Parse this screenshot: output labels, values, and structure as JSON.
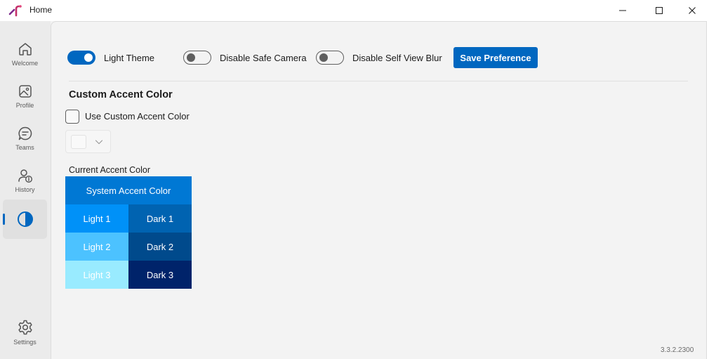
{
  "window": {
    "title": "Home"
  },
  "sidebar": {
    "items": [
      {
        "label": "Welcome",
        "icon": "home-icon"
      },
      {
        "label": "Profile",
        "icon": "image-icon"
      },
      {
        "label": "Teams",
        "icon": "chat-icon"
      },
      {
        "label": "History",
        "icon": "person-info-icon"
      },
      {
        "label": "",
        "icon": "contrast-icon",
        "active": true
      }
    ],
    "footer_item": {
      "label": "Settings",
      "icon": "gear-icon"
    }
  },
  "preferences": {
    "light_theme": {
      "label": "Light Theme",
      "on": true
    },
    "disable_safe_camera": {
      "label": "Disable Safe Camera",
      "on": false
    },
    "disable_self_view_blur": {
      "label": "Disable Self View Blur",
      "on": false
    },
    "save_label": "Save Preference"
  },
  "custom_accent": {
    "section_title": "Custom Accent Color",
    "checkbox_label": "Use Custom Accent Color",
    "checked": false
  },
  "current_accent": {
    "label": "Current Accent Color",
    "system": {
      "label": "System Accent Color",
      "color": "#0078d4"
    },
    "light1": {
      "label": "Light 1",
      "color": "#0091f8"
    },
    "dark1": {
      "label": "Dark 1",
      "color": "#0063b1"
    },
    "light2": {
      "label": "Light 2",
      "color": "#4cc2ff"
    },
    "dark2": {
      "label": "Dark 2",
      "color": "#004a8c"
    },
    "light3": {
      "label": "Light 3",
      "color": "#99ebff"
    },
    "dark3": {
      "label": "Dark 3",
      "color": "#00236a"
    }
  },
  "colors": {
    "accent": "#0067c0"
  },
  "version": "3.3.2.2300"
}
